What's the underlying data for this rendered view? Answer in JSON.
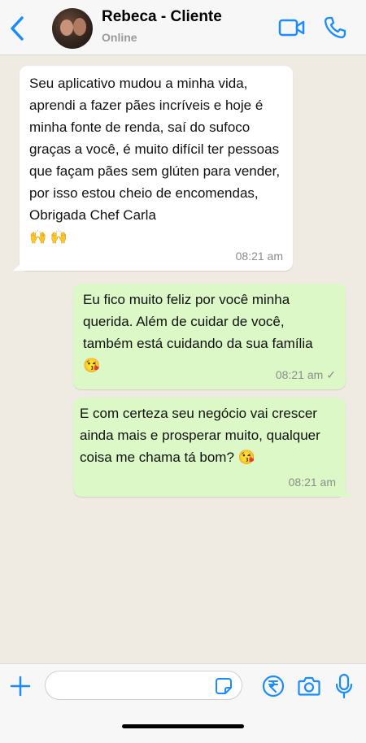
{
  "header": {
    "contact_name": "Rebeca - Cliente",
    "status": "Online",
    "icons": {
      "back": "chevron-left-icon",
      "video": "video-camera-icon",
      "call": "phone-icon"
    },
    "accent_color": "#1a8cff"
  },
  "messages": [
    {
      "direction": "incoming",
      "text": "Seu aplicativo mudou a minha vida, aprendi a fazer pães incríveis e hoje é minha fonte de renda, saí do sufoco graças a você, é muito difícil ter pessoas que façam pães sem glúten para vender, por isso estou cheio de encomendas, Obrigada Chef Carla\n🙌 🙌",
      "time": "08:21 am"
    },
    {
      "direction": "outgoing",
      "text": "Eu fico muito feliz por você minha querida. Além de cuidar de você, também está cuidando da sua família\n😘",
      "time": "08:21 am",
      "status": "✓"
    },
    {
      "direction": "outgoing",
      "text": "E com certeza seu negócio vai crescer ainda mais e prosperar muito, qualquer coisa me chama tá bom? 😘",
      "time": "08:21 am"
    }
  ],
  "composer": {
    "placeholder": "",
    "value": "",
    "icons": {
      "plus": "plus-icon",
      "sticker": "sticker-icon",
      "payment": "rupee-payment-icon",
      "camera": "camera-icon",
      "mic": "microphone-icon"
    }
  },
  "colors": {
    "incoming_bubble": "#ffffff",
    "outgoing_bubble": "#dcf8c6",
    "chat_background": "#efebe3"
  }
}
